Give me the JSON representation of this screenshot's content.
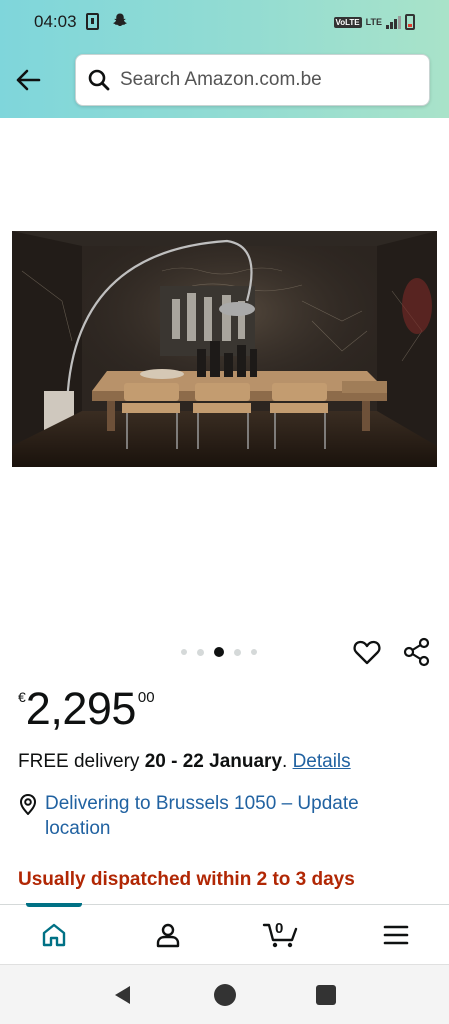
{
  "status_bar": {
    "time": "04:03",
    "volte": "VoLTE",
    "network": "LTE"
  },
  "header": {
    "back_icon": "arrow-left-icon",
    "search_placeholder": "Search Amazon.com.be"
  },
  "product": {
    "image_icon": "dining-room-photo",
    "carousel": {
      "count": 5,
      "active_index": 2
    },
    "price": {
      "currency": "€",
      "whole": "2,295",
      "fraction": "00"
    },
    "delivery": {
      "prefix": "FREE delivery ",
      "dates": "20 - 22 January",
      "suffix": ". ",
      "details_link": "Details"
    },
    "location_text": "Delivering to Brussels 1050 – Update location",
    "dispatch_text": "Usually dispatched within 2 to 3 days"
  },
  "bottom_nav": {
    "items": [
      "home-icon",
      "account-icon",
      "cart-icon",
      "menu-icon"
    ],
    "cart_count": "0",
    "active": "home"
  },
  "colors": {
    "link": "#2162a1",
    "dispatch": "#B12704",
    "active_nav": "#007185",
    "header_gradient_start": "#7fd6db",
    "header_gradient_end": "#a9e3c9"
  }
}
